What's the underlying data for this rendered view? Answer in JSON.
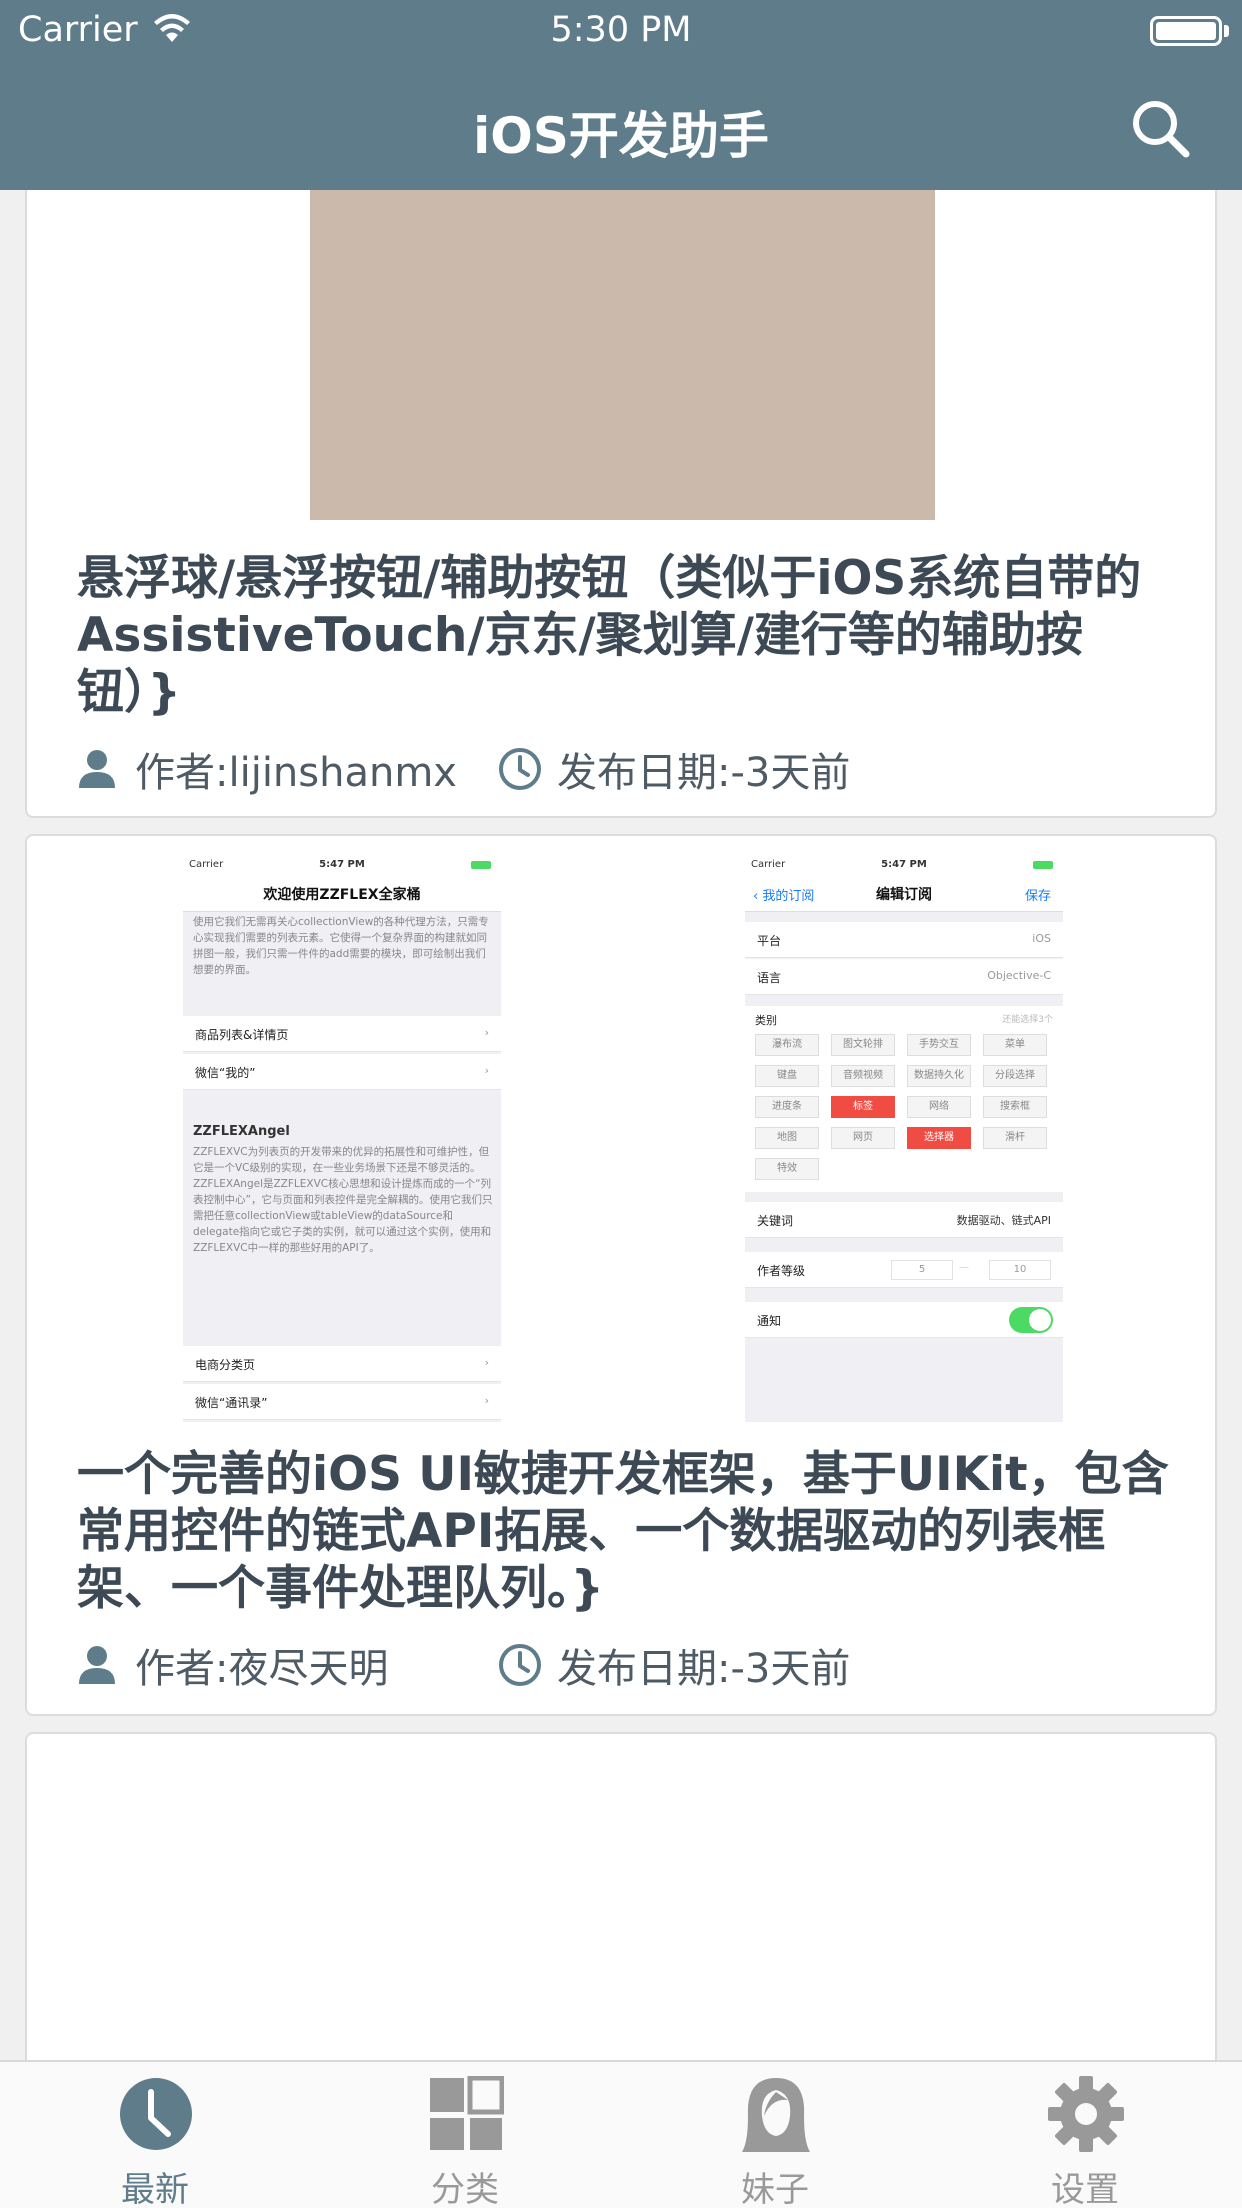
{
  "status_bar": {
    "carrier": "Carrier",
    "time": "5:30 PM"
  },
  "nav": {
    "title": "iOS开发助手",
    "search_icon": "search-icon"
  },
  "colors": {
    "nav_bg": "#5f7c8a",
    "accent": "#5f7c8a",
    "chip_active": "#f04c44",
    "toggle_on": "#4cd964"
  },
  "articles": [
    {
      "title": "悬浮球/悬浮按钮/辅助按钮（类似于iOS系统自带的AssistiveTouch/京东/聚划算/建行等的辅助按钮）}",
      "author": "作者:lijinshanmx",
      "date": "发布日期:-3天前"
    },
    {
      "title": "一个完善的iOS UI敏捷开发框架，基于UIKit，包含常用控件的链式API拓展、一个数据驱动的列表框架、一个事件处理队列。}",
      "author": "作者:夜尽天明",
      "date": "发布日期:-3天前",
      "screenshot_left": {
        "status_carrier": "Carrier",
        "status_time": "5:47 PM",
        "title": "欢迎使用ZZFLEX全家桶",
        "intro": "使用它我们无需再关心collectionView的各种代理方法，只需专心实现我们需要的列表元素。它使得一个复杂界面的构建就如同拼图一般，我们只需一件件的add需要的模块，即可绘制出我们想要的界面。",
        "rows": [
          "商品列表&详情页",
          "微信“我的”"
        ],
        "heading": "ZZFLEXAngel",
        "body": "ZZFLEXVC为列表页的开发带来的优异的拓展性和可维护性，但它是一个VC级别的实现，在一些业务场景下还是不够灵活的。ZZFLEXAngel是ZZFLEXVC核心思想和设计提炼而成的一个“列表控制中心”，它与页面和列表控件是完全解耦的。使用它我们只需把任意collectionView或tableView的dataSource和delegate指向它或它子类的实例，就可以通过这个实例，使用和ZZFLEXVC中一样的那些好用的API了。",
        "rows2": [
          "电商分类页",
          "微信“通讯录”"
        ]
      },
      "screenshot_right": {
        "status_carrier": "Carrier",
        "status_time": "5:47 PM",
        "back": "我的订阅",
        "title": "编辑订阅",
        "save": "保存",
        "rows": [
          {
            "label": "平台",
            "value": "iOS"
          },
          {
            "label": "语言",
            "value": "Objective-C"
          }
        ],
        "category_label": "类别",
        "category_hint": "还能选择3个",
        "chips": [
          "瀑布流",
          "图文轮排",
          "手势交互",
          "菜单",
          "键盘",
          "音频视频",
          "数据持久化",
          "分段选择",
          "进度条",
          "标签",
          "网络",
          "搜索框",
          "地图",
          "网页",
          "选择器",
          "滑杆",
          "特效"
        ],
        "chips_active": [
          "标签",
          "选择器"
        ],
        "keyword_label": "关键词",
        "keyword_value": "数据驱动、链式API",
        "level_label": "作者等级",
        "level_min": "5",
        "level_sep": "—",
        "level_max": "10",
        "notify_label": "通知"
      }
    }
  ],
  "tabbar": {
    "tabs": [
      {
        "label": "最新",
        "icon": "clock-icon",
        "active": true
      },
      {
        "label": "分类",
        "icon": "grid-icon",
        "active": false
      },
      {
        "label": "妹子",
        "icon": "girl-icon",
        "active": false
      },
      {
        "label": "设置",
        "icon": "gear-icon",
        "active": false
      }
    ]
  }
}
